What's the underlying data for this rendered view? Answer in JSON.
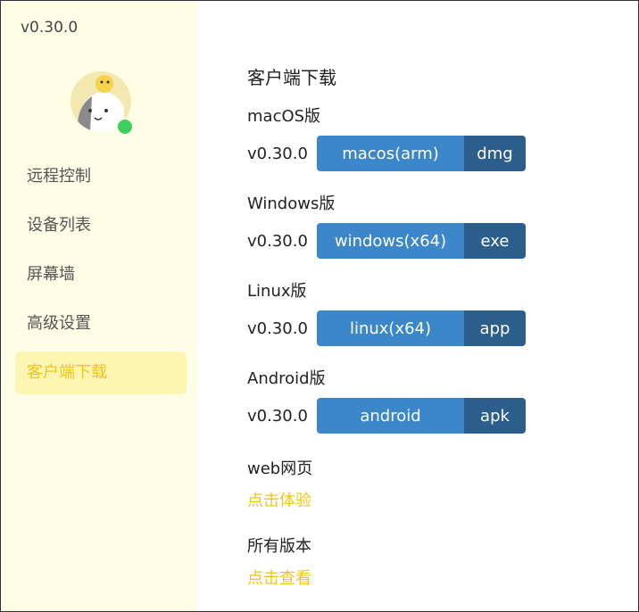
{
  "sidebar": {
    "version": "v0.30.0",
    "avatar_name": "avatar",
    "status": "online",
    "items": [
      {
        "label": "远程控制"
      },
      {
        "label": "设备列表"
      },
      {
        "label": "屏幕墙"
      },
      {
        "label": "高级设置"
      },
      {
        "label": "客户端下载"
      }
    ],
    "active_index": 4
  },
  "main": {
    "title": "客户端下载",
    "platforms": [
      {
        "label": "macOS版",
        "version": "v0.30.0",
        "button": "macos(arm)",
        "ext": "dmg"
      },
      {
        "label": "Windows版",
        "version": "v0.30.0",
        "button": "windows(x64)",
        "ext": "exe"
      },
      {
        "label": "Linux版",
        "version": "v0.30.0",
        "button": "linux(x64)",
        "ext": "app"
      },
      {
        "label": "Android版",
        "version": "v0.30.0",
        "button": "android",
        "ext": "apk"
      }
    ],
    "web": {
      "label": "web网页",
      "link": "点击体验"
    },
    "all_versions": {
      "label": "所有版本",
      "link": "点击查看"
    }
  },
  "colors": {
    "sidebar_bg": "#fffde6",
    "active_bg": "#fff5b3",
    "accent": "#f0c419",
    "button_main": "#3b87c9",
    "button_ext": "#2c5e8c",
    "online": "#3fcf5d"
  }
}
